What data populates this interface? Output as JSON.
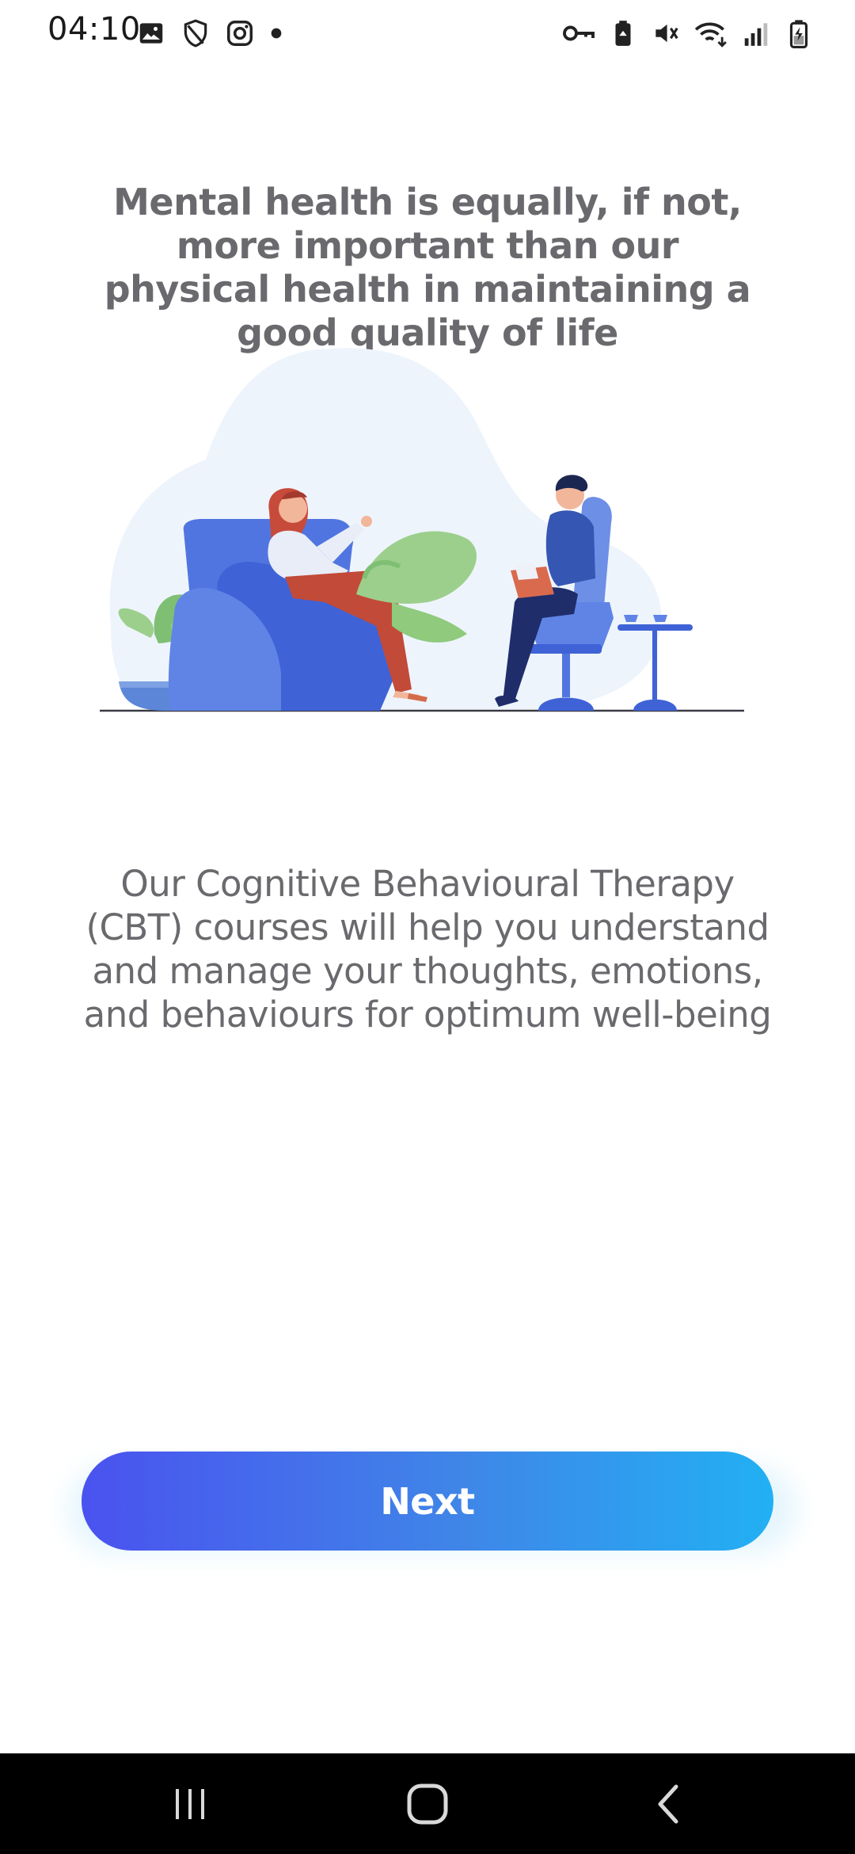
{
  "status_bar": {
    "time": "04:10",
    "left_icons": [
      "image-icon",
      "shield-icon",
      "instagram-icon",
      "dot-icon"
    ],
    "right_icons": [
      "vpn-key-icon",
      "battery-saver-icon",
      "vibrate-mute-icon",
      "wifi-icon",
      "signal-icon",
      "battery-charging-icon"
    ]
  },
  "onboarding": {
    "heading": "Mental health is equally, if not, more important than our physical health in maintaining a good quality of life",
    "illustration_icon": "therapy-session-illustration",
    "description": "Our Cognitive Behavioural Therapy (CBT) courses will help you understand and manage your thoughts, emotions, and behaviours for optimum well-being",
    "next_label": "Next"
  },
  "nav_bar": {
    "icons": [
      "recent-apps-icon",
      "home-icon",
      "back-icon"
    ]
  },
  "colors": {
    "text": "#6a6a6e",
    "button_gradient_start": "#4a52ef",
    "button_gradient_end": "#22b0f3",
    "illustration_blob": "#eef4fc",
    "chair_blue": "#3f63d6"
  }
}
